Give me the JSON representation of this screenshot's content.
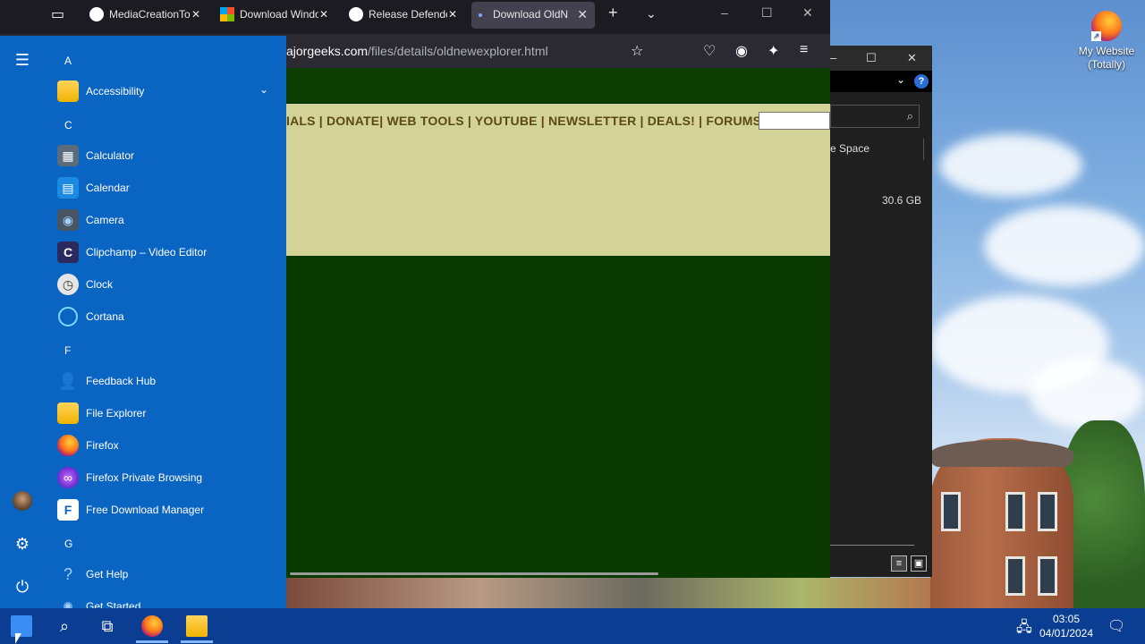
{
  "browser": {
    "tabs": [
      {
        "title": "MediaCreationTo",
        "icon": "github-icon"
      },
      {
        "title": "Download Windo",
        "icon": "microsoft-icon"
      },
      {
        "title": "Release Defende",
        "icon": "github-icon"
      },
      {
        "title": "Download OldN",
        "icon": "page-icon",
        "active": true
      }
    ],
    "url_domain": "ajorgeeks.com",
    "url_path": "/files/details/oldnewexplorer.html",
    "page_menu_text": "IALS | DONATE| WEB TOOLS | YOUTUBE | NEWSLETTER | DEALS! | FORUMS |"
  },
  "explorer": {
    "column_header": "e Space",
    "free_space": "30.6 GB"
  },
  "desktop": {
    "icon_label_1": "My Website",
    "icon_label_2": "(Totally)"
  },
  "start_menu": {
    "letters": [
      "A",
      "C",
      "F",
      "G"
    ],
    "apps_a": [
      {
        "label": "Accessibility",
        "icon": "folder-icon",
        "has_chevron": true
      }
    ],
    "apps_c": [
      {
        "label": "Calculator",
        "icon": "calculator-icon"
      },
      {
        "label": "Calendar",
        "icon": "calendar-icon"
      },
      {
        "label": "Camera",
        "icon": "camera-icon"
      },
      {
        "label": "Clipchamp – Video Editor",
        "icon": "clipchamp-icon"
      },
      {
        "label": "Clock",
        "icon": "clock-icon"
      },
      {
        "label": "Cortana",
        "icon": "cortana-icon"
      }
    ],
    "apps_f": [
      {
        "label": "Feedback Hub",
        "icon": "feedback-icon"
      },
      {
        "label": "File Explorer",
        "icon": "folder-icon"
      },
      {
        "label": "Firefox",
        "icon": "firefox-icon"
      },
      {
        "label": "Firefox Private Browsing",
        "icon": "private-browsing-icon"
      },
      {
        "label": "Free Download Manager",
        "icon": "download-manager-icon"
      }
    ],
    "apps_g": [
      {
        "label": "Get Help",
        "icon": "help-icon"
      },
      {
        "label": "Get Started",
        "icon": "get-started-icon"
      }
    ]
  },
  "taskbar": {
    "time": "03:05",
    "date": "04/01/2024"
  },
  "colors": {
    "start_bg": "#0a64c2",
    "taskbar_bg": "#0b3e92",
    "page_menu_bg": "#d3d297",
    "page_menu_text": "#5b4a14",
    "page_bg": "#0b3a00"
  }
}
